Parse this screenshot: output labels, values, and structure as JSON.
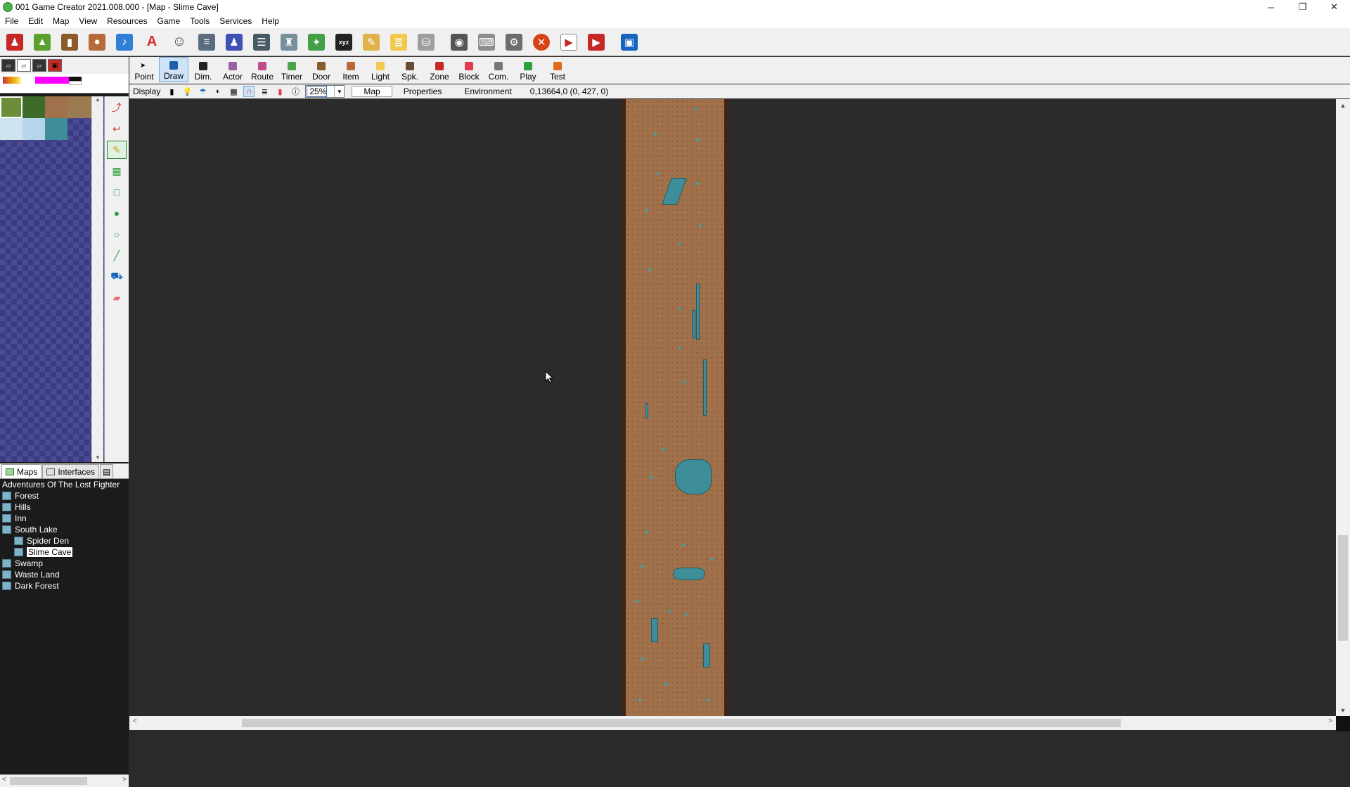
{
  "window": {
    "title": "001 Game Creator 2021.008.000 - [Map - Slime Cave]",
    "minimize": "─",
    "restore": "❐",
    "close": "✕"
  },
  "menu": [
    "File",
    "Edit",
    "Map",
    "View",
    "Resources",
    "Game",
    "Tools",
    "Services",
    "Help"
  ],
  "map_tools": [
    {
      "label": "Point",
      "color": "#ffffff"
    },
    {
      "label": "Draw",
      "color": "#1d5fa8"
    },
    {
      "label": "Dim.",
      "color": "#222222"
    },
    {
      "label": "Actor",
      "color": "#9b5fa5"
    },
    {
      "label": "Route",
      "color": "#c24a86"
    },
    {
      "label": "Timer",
      "color": "#4aa34a"
    },
    {
      "label": "Door",
      "color": "#8b5a2b"
    },
    {
      "label": "Item",
      "color": "#b86b3a"
    },
    {
      "label": "Light",
      "color": "#f2c94c"
    },
    {
      "label": "Spk.",
      "color": "#6b4a2f"
    },
    {
      "label": "Zone",
      "color": "#c62828"
    },
    {
      "label": "Block",
      "color": "#e53950"
    },
    {
      "label": "Com.",
      "color": "#777777"
    },
    {
      "label": "Play",
      "color": "#2e9e3e"
    },
    {
      "label": "Test",
      "color": "#e06a1b"
    }
  ],
  "display": {
    "label": "Display",
    "zoom": "25%",
    "tabs": [
      "Map",
      "Properties",
      "Environment"
    ],
    "coords": "0,13664,0 (0, 427, 0)"
  },
  "panel_tabs": [
    "Maps",
    "Interfaces"
  ],
  "tree": {
    "root": "Adventures Of The Lost Fighter",
    "items": [
      {
        "label": "Forest",
        "indent": 0
      },
      {
        "label": "Hills",
        "indent": 0
      },
      {
        "label": "Inn",
        "indent": 0
      },
      {
        "label": "South Lake",
        "indent": 0
      },
      {
        "label": "Spider Den",
        "indent": 1
      },
      {
        "label": "Slime Cave",
        "indent": 1,
        "selected": true
      },
      {
        "label": "Swamp",
        "indent": 0
      },
      {
        "label": "Waste Land",
        "indent": 0
      },
      {
        "label": "Dark Forest",
        "indent": 0
      }
    ]
  },
  "toolbar_icons": [
    "hero-icon",
    "map-icon",
    "door-icon",
    "bag-icon",
    "music-icon",
    "font-icon",
    "character-icon",
    "document-icon",
    "party-icon",
    "list-icon",
    "armor-icon",
    "skills-icon",
    "xyz-icon",
    "note-icon",
    "scroll-icon",
    "database-icon",
    "gamepad-icon",
    "keyboard-icon",
    "gear-icon",
    "shield-icon",
    "play-icon",
    "record-icon",
    "save-icon"
  ],
  "drawing_tools": [
    "curve-icon",
    "hook-icon",
    "pencil-icon",
    "checker-icon",
    "rectangle-icon",
    "fill-circle-icon",
    "circle-icon",
    "line-icon",
    "bucket-icon",
    "eraser-icon"
  ],
  "colors": {
    "cave_floor": "#a0714a",
    "cave_wall": "#3f2218",
    "water": "#3e8e9a",
    "canvas": "#2b2b2b"
  }
}
